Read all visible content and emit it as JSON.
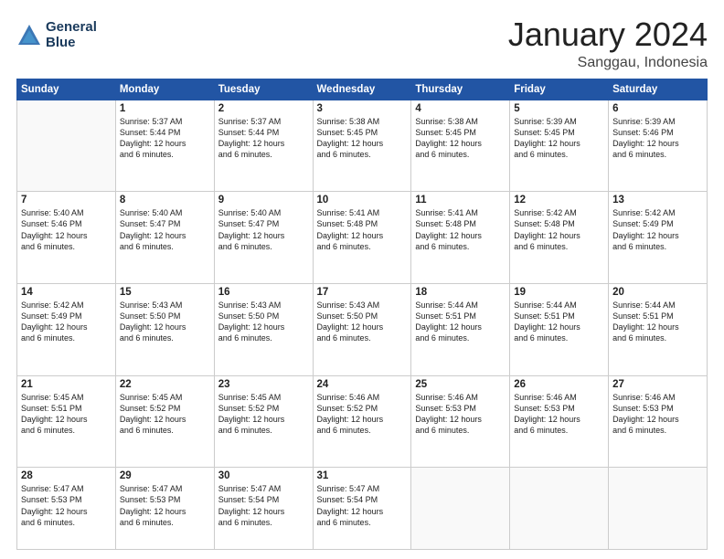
{
  "logo": {
    "line1": "General",
    "line2": "Blue"
  },
  "title": "January 2024",
  "subtitle": "Sanggau, Indonesia",
  "weekdays": [
    "Sunday",
    "Monday",
    "Tuesday",
    "Wednesday",
    "Thursday",
    "Friday",
    "Saturday"
  ],
  "weeks": [
    [
      {
        "day": null,
        "info": null
      },
      {
        "day": "1",
        "info": "Sunrise: 5:37 AM\nSunset: 5:44 PM\nDaylight: 12 hours\nand 6 minutes."
      },
      {
        "day": "2",
        "info": "Sunrise: 5:37 AM\nSunset: 5:44 PM\nDaylight: 12 hours\nand 6 minutes."
      },
      {
        "day": "3",
        "info": "Sunrise: 5:38 AM\nSunset: 5:45 PM\nDaylight: 12 hours\nand 6 minutes."
      },
      {
        "day": "4",
        "info": "Sunrise: 5:38 AM\nSunset: 5:45 PM\nDaylight: 12 hours\nand 6 minutes."
      },
      {
        "day": "5",
        "info": "Sunrise: 5:39 AM\nSunset: 5:45 PM\nDaylight: 12 hours\nand 6 minutes."
      },
      {
        "day": "6",
        "info": "Sunrise: 5:39 AM\nSunset: 5:46 PM\nDaylight: 12 hours\nand 6 minutes."
      }
    ],
    [
      {
        "day": "7",
        "info": "Sunrise: 5:40 AM\nSunset: 5:46 PM\nDaylight: 12 hours\nand 6 minutes."
      },
      {
        "day": "8",
        "info": "Sunrise: 5:40 AM\nSunset: 5:47 PM\nDaylight: 12 hours\nand 6 minutes."
      },
      {
        "day": "9",
        "info": "Sunrise: 5:40 AM\nSunset: 5:47 PM\nDaylight: 12 hours\nand 6 minutes."
      },
      {
        "day": "10",
        "info": "Sunrise: 5:41 AM\nSunset: 5:48 PM\nDaylight: 12 hours\nand 6 minutes."
      },
      {
        "day": "11",
        "info": "Sunrise: 5:41 AM\nSunset: 5:48 PM\nDaylight: 12 hours\nand 6 minutes."
      },
      {
        "day": "12",
        "info": "Sunrise: 5:42 AM\nSunset: 5:48 PM\nDaylight: 12 hours\nand 6 minutes."
      },
      {
        "day": "13",
        "info": "Sunrise: 5:42 AM\nSunset: 5:49 PM\nDaylight: 12 hours\nand 6 minutes."
      }
    ],
    [
      {
        "day": "14",
        "info": "Sunrise: 5:42 AM\nSunset: 5:49 PM\nDaylight: 12 hours\nand 6 minutes."
      },
      {
        "day": "15",
        "info": "Sunrise: 5:43 AM\nSunset: 5:50 PM\nDaylight: 12 hours\nand 6 minutes."
      },
      {
        "day": "16",
        "info": "Sunrise: 5:43 AM\nSunset: 5:50 PM\nDaylight: 12 hours\nand 6 minutes."
      },
      {
        "day": "17",
        "info": "Sunrise: 5:43 AM\nSunset: 5:50 PM\nDaylight: 12 hours\nand 6 minutes."
      },
      {
        "day": "18",
        "info": "Sunrise: 5:44 AM\nSunset: 5:51 PM\nDaylight: 12 hours\nand 6 minutes."
      },
      {
        "day": "19",
        "info": "Sunrise: 5:44 AM\nSunset: 5:51 PM\nDaylight: 12 hours\nand 6 minutes."
      },
      {
        "day": "20",
        "info": "Sunrise: 5:44 AM\nSunset: 5:51 PM\nDaylight: 12 hours\nand 6 minutes."
      }
    ],
    [
      {
        "day": "21",
        "info": "Sunrise: 5:45 AM\nSunset: 5:51 PM\nDaylight: 12 hours\nand 6 minutes."
      },
      {
        "day": "22",
        "info": "Sunrise: 5:45 AM\nSunset: 5:52 PM\nDaylight: 12 hours\nand 6 minutes."
      },
      {
        "day": "23",
        "info": "Sunrise: 5:45 AM\nSunset: 5:52 PM\nDaylight: 12 hours\nand 6 minutes."
      },
      {
        "day": "24",
        "info": "Sunrise: 5:46 AM\nSunset: 5:52 PM\nDaylight: 12 hours\nand 6 minutes."
      },
      {
        "day": "25",
        "info": "Sunrise: 5:46 AM\nSunset: 5:53 PM\nDaylight: 12 hours\nand 6 minutes."
      },
      {
        "day": "26",
        "info": "Sunrise: 5:46 AM\nSunset: 5:53 PM\nDaylight: 12 hours\nand 6 minutes."
      },
      {
        "day": "27",
        "info": "Sunrise: 5:46 AM\nSunset: 5:53 PM\nDaylight: 12 hours\nand 6 minutes."
      }
    ],
    [
      {
        "day": "28",
        "info": "Sunrise: 5:47 AM\nSunset: 5:53 PM\nDaylight: 12 hours\nand 6 minutes."
      },
      {
        "day": "29",
        "info": "Sunrise: 5:47 AM\nSunset: 5:53 PM\nDaylight: 12 hours\nand 6 minutes."
      },
      {
        "day": "30",
        "info": "Sunrise: 5:47 AM\nSunset: 5:54 PM\nDaylight: 12 hours\nand 6 minutes."
      },
      {
        "day": "31",
        "info": "Sunrise: 5:47 AM\nSunset: 5:54 PM\nDaylight: 12 hours\nand 6 minutes."
      },
      {
        "day": null,
        "info": null
      },
      {
        "day": null,
        "info": null
      },
      {
        "day": null,
        "info": null
      }
    ]
  ]
}
